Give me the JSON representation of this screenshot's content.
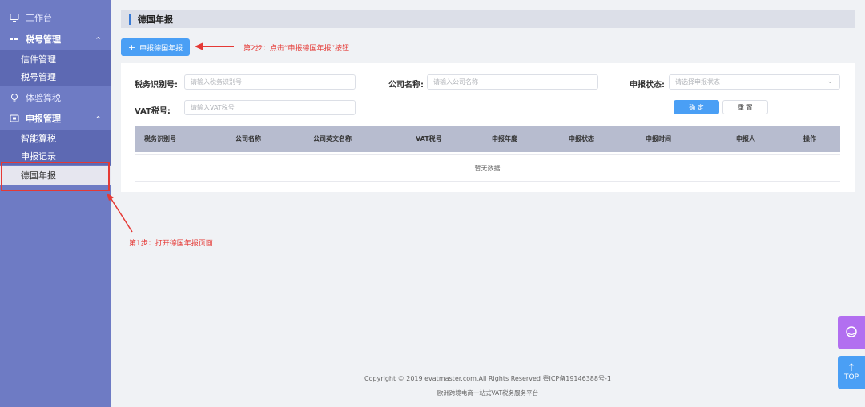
{
  "sidebar": {
    "workbench": "工作台",
    "tax_mgmt": "税号管理",
    "letter_mgmt": "信件管理",
    "taxno_mgmt": "税号管理",
    "trial_calc": "体验算税",
    "declare_mgmt": "申报管理",
    "smart_calc": "智能算税",
    "declare_records": "申报记录",
    "germany_annual": "德国年报"
  },
  "annotations": {
    "step1": "第1步：打开德国年报页面",
    "step2": "第2步：点击“申报德国年报”按钮"
  },
  "page": {
    "title": "德国年报",
    "new_button": "申报德国年报"
  },
  "filters": {
    "tax_id_label": "税务识别号:",
    "tax_id_placeholder": "请输入税务识别号",
    "company_label": "公司名称:",
    "company_placeholder": "请输入公司名称",
    "status_label": "申报状态:",
    "status_placeholder": "请选择申报状态",
    "vat_label": "VAT税号:",
    "vat_placeholder": "请输入VAT税号",
    "confirm": "确 定",
    "reset": "重 置"
  },
  "table": {
    "columns": [
      "税务识别号",
      "公司名称",
      "公司英文名称",
      "VAT税号",
      "申报年度",
      "申报状态",
      "申报时间",
      "申报人",
      "操作"
    ],
    "empty": "暂无数据"
  },
  "footer": {
    "copyright": "Copyright © 2019 evatmaster.com,All Rights Reserved 粤ICP备19146388号-1",
    "tagline": "欧洲跨境电商一站式VAT税务服务平台"
  },
  "float": {
    "top_label": "TOP"
  },
  "colors": {
    "sidebar": "#6e7bc4",
    "primary": "#4a9ff5",
    "annotation": "#e53935"
  }
}
